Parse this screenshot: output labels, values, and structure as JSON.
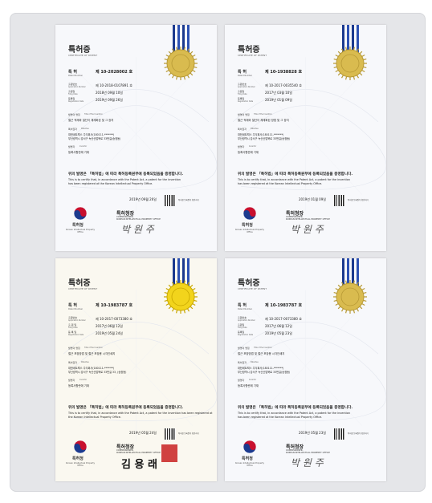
{
  "certificates": [
    {
      "title": "특허증",
      "subtitle": "CERTIFICATE OF PATENT",
      "patent_label": "특 허",
      "patent_label_en": "Patent Number",
      "patent_number": "제 10-2028002 호",
      "app_number_label": "출원번호",
      "app_number_label_en": "Application Number",
      "app_number": "제 10-2018-0107891 호",
      "filing_label": "출원일",
      "filing_label_en": "Filing Date",
      "filing_date": "2018년 09월 10일",
      "reg_label": "등록일",
      "reg_label_en": "Registration Date",
      "reg_date": "2019년 09월 26일",
      "invention_label": "발명의 명칭",
      "invention_label_en": "Title of the Invention",
      "invention": "철근 적재와 절단이 체계화된 및 그 장치",
      "owner_label": "특허권자",
      "owner_label_en": "Patentee",
      "owner": "대한네트웍스 주식회사(180111-*******)",
      "owner_addr": "부산광역시 강서구 녹산산업북로 33번길(송정동)",
      "inventor_label": "발명자",
      "inventor_label_en": "Inventor",
      "inventor": "등록사항란에 기재",
      "statement": "위의 발명은 「특허법」에 따라 특허등록원부에 등록되었음을 증명합니다.",
      "statement_en_1": "This is to certify that, in accordance with the Patent Act, a patent for the invention",
      "statement_en_2": "has been registered at the Korean Intellectual Property Office.",
      "issue_date": "2019년 09월 26일",
      "qr_text": "특허청 등록원부 확인하기",
      "commissioner": "특허청장",
      "commissioner_en_1": "COMMISSIONER,",
      "commissioner_en_2": "KOREAN INTELLECTUAL PROPERTY OFFICE",
      "signature": "박 원 주",
      "kipo": "특허청",
      "kipo_en": "Korean Intellectual Property Office"
    },
    {
      "title": "특허증",
      "subtitle": "CERTIFICATE OF PATENT",
      "patent_label": "특 허",
      "patent_label_en": "Patent Number",
      "patent_number": "제 10-1938828 호",
      "app_number_label": "출원번호",
      "app_number_label_en": "Application Number",
      "app_number": "제 10-2017-0035540 호",
      "filing_label": "출원일",
      "filing_label_en": "Filing Date",
      "filing_date": "2017년 03월 10일",
      "reg_label": "등록일",
      "reg_label_en": "Registration Date",
      "reg_date": "2019년 01월 09일",
      "invention_label": "발명의 명칭",
      "invention_label_en": "Title of the Invention",
      "invention": "철근 적재와 절단이 체계화된 방법 및 그 장치",
      "owner_label": "특허권자",
      "owner_label_en": "Patentee",
      "owner": "대한네트웍스 주식회사(180111-*******)",
      "owner_addr": "부산광역시 강서구 녹산산업북로 33번길(송정동)",
      "inventor_label": "발명자",
      "inventor_label_en": "Inventor",
      "inventor": "등록사항란에 기재",
      "statement": "위의 발명은 「특허법」에 따라 특허등록원부에 등록되었음을 증명합니다.",
      "statement_en_1": "This is to certify that, in accordance with the Patent Act, a patent for the invention",
      "statement_en_2": "has been registered at the Korean Intellectual Property Office.",
      "issue_date": "2019년 01월 09일",
      "qr_text": "특허청 등록원부 확인하기",
      "commissioner": "특허청장",
      "commissioner_en_1": "COMMISSIONER,",
      "commissioner_en_2": "KOREAN INTELLECTUAL PROPERTY OFFICE",
      "signature": "박 원 주",
      "kipo": "특허청",
      "kipo_en": "Korean Intellectual Property Office"
    },
    {
      "title": "특허증",
      "subtitle": "CERTIFICATE OF PATENT",
      "patent_label": "특 허",
      "patent_label_en": "Patent Number",
      "patent_number": "제 10-1983787 호",
      "app_number_label": "출원번호",
      "app_number_label_en": "Application Number",
      "app_number": "제 10-2017-0073380 호",
      "filing_label": "출 원 일",
      "filing_label_en": "Filing Date",
      "filing_date": "2017년 06월 12일",
      "reg_label": "등 록 일",
      "reg_label_en": "Registration Date",
      "reg_date": "2019년 05월 24일",
      "invention_label": "발명의 명칭",
      "invention_label_en": "Title of the Invention",
      "invention": "철근 포장방법 및 철근 포장용 시각인쇄지",
      "owner_label": "특허권자",
      "owner_label_en": "Patentee",
      "owner": "대한네트웍스 주식회사(180111-*******)",
      "owner_addr": "부산광역시 강서구 녹산산업북로 33번길 33, (송정동)",
      "inventor_label": "발명자",
      "inventor_label_en": "Inventor",
      "inventor": "등록사항란에 기재",
      "statement": "위의 발명은 「특허법」에 따라 특허등록원부에 등록되었음을 증명합니다.",
      "statement_en_1": "This is to certify that, in accordance with the Patent Act, a patent for the invention has been registered at",
      "statement_en_2": "the Korean Intellectual Property Office.",
      "issue_date": "2019년 05월 24일",
      "qr_text": "특허청 등록원부 확인하기",
      "commissioner": "특허청장",
      "commissioner_en_1": "COMMISSIONER,",
      "commissioner_en_2": "KOREAN INTELLECTUAL PROPERTY OFFICE",
      "signature": "김 용 래",
      "kipo": "특허청",
      "kipo_en": "Korean Intellectual Property Office"
    },
    {
      "title": "특허증",
      "subtitle": "CERTIFICATE OF PATENT",
      "patent_label": "특 허",
      "patent_label_en": "Patent Number",
      "patent_number": "제 10-1983787 호",
      "app_number_label": "출원번호",
      "app_number_label_en": "Application Number",
      "app_number": "제 10-2017-0073380 호",
      "filing_label": "출원일",
      "filing_label_en": "Filing Date",
      "filing_date": "2017년 06월 12일",
      "reg_label": "등록일",
      "reg_label_en": "Registration Date",
      "reg_date": "2019년 05월 23일",
      "invention_label": "발명의 명칭",
      "invention_label_en": "Title of the Invention",
      "invention": "철근 포장방법 및 철근 포장용 시각인쇄지",
      "owner_label": "특허권자",
      "owner_label_en": "Patentee",
      "owner": "대한네트웍스 주식회사(180111-*******)",
      "owner_addr": "부산광역시 강서구 녹산산업북로 33번길(송정동)",
      "inventor_label": "발명자",
      "inventor_label_en": "Inventor",
      "inventor": "등록사항란에 기재",
      "statement": "위의 발명은 「특허법」에 따라 특허등록원부에 등록되었음을 증명합니다.",
      "statement_en_1": "This is to certify that, in accordance with the Patent Act, a patent for the invention",
      "statement_en_2": "has been registered at the Korean Intellectual Property Office.",
      "issue_date": "2019년 05월 23일",
      "qr_text": "특허청 등록원부 확인하기",
      "commissioner": "특허청장",
      "commissioner_en_1": "COMMISSIONER,",
      "commissioner_en_2": "KOREAN INTELLECTUAL PROPERTY OFFICE",
      "signature": "박 원 주",
      "kipo": "특허청",
      "kipo_en": "Korean Intellectual Property Office"
    }
  ],
  "colors": {
    "panel_bg": "#e5e6e9",
    "ribbon": "#1c3a8e",
    "seal_gold": "#d8b84a",
    "seal_yellow": "#f0d21a",
    "stamp_red": "#c82222",
    "kipo_red": "#c8102e",
    "kipo_blue": "#1c3a8e"
  },
  "icons": [
    "gold-seal-icon",
    "qr-code-icon",
    "kipo-taegeuk-logo-icon",
    "official-red-stamp-icon"
  ]
}
